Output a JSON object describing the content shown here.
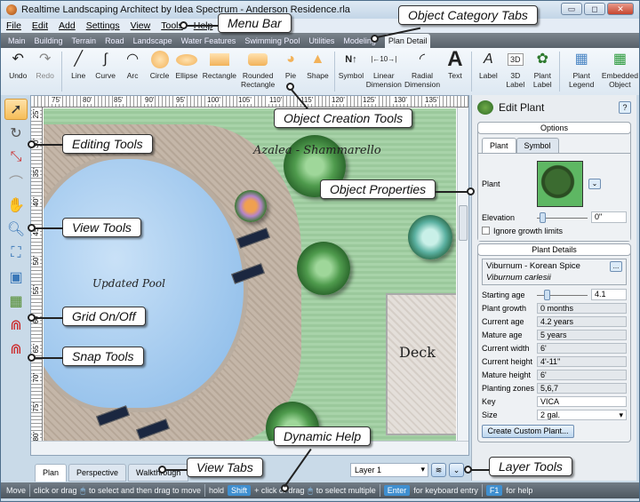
{
  "window": {
    "title": "Realtime Landscaping Architect by Idea Spectrum - Anderson Residence.rla",
    "controls": [
      "minimize",
      "maximize",
      "close"
    ]
  },
  "menu": [
    "File",
    "Edit",
    "Add",
    "Settings",
    "View",
    "Tools",
    "Help"
  ],
  "category_tabs": {
    "items": [
      "Main",
      "Building",
      "Terrain",
      "Road",
      "Landscape",
      "Water Features",
      "Swimming Pool",
      "Utilities",
      "Modeling",
      "Plan Detail"
    ],
    "active": "Plan Detail"
  },
  "ribbon": {
    "history": [
      {
        "label": "Undo",
        "icon": "undo-icon",
        "enabled": true
      },
      {
        "label": "Redo",
        "icon": "redo-icon",
        "enabled": false
      }
    ],
    "shapes": [
      {
        "label": "Line",
        "icon": "line-icon"
      },
      {
        "label": "Curve",
        "icon": "curve-icon"
      },
      {
        "label": "Arc",
        "icon": "arc-icon"
      },
      {
        "label": "Circle",
        "icon": "circle-icon"
      },
      {
        "label": "Ellipse",
        "icon": "ellipse-icon"
      },
      {
        "label": "Rectangle",
        "icon": "rectangle-icon"
      },
      {
        "label": "Rounded Rectangle",
        "icon": "rounded-rectangle-icon"
      },
      {
        "label": "Pie",
        "icon": "pie-icon"
      },
      {
        "label": "Shape",
        "icon": "shape-icon"
      }
    ],
    "annotations": [
      {
        "label": "Symbol",
        "icon": "north-arrow-icon"
      },
      {
        "label": "Linear Dimension",
        "icon": "linear-dimension-icon"
      },
      {
        "label": "Radial Dimension",
        "icon": "radial-dimension-icon"
      },
      {
        "label": "Text",
        "icon": "text-icon"
      }
    ],
    "labels": [
      {
        "label": "Label",
        "icon": "label-icon"
      },
      {
        "label": "3D Label",
        "icon": "3d-label-icon"
      },
      {
        "label": "Plant Label",
        "icon": "plant-label-icon"
      }
    ],
    "objects": [
      {
        "label": "Plant Legend",
        "icon": "plant-legend-icon"
      },
      {
        "label": "Embedded Object",
        "icon": "embedded-object-icon"
      }
    ]
  },
  "rulers": {
    "horizontal": [
      "75'",
      "80'",
      "85'",
      "90'",
      "95'",
      "100'",
      "105'",
      "110'",
      "115'",
      "120'",
      "125'",
      "130'",
      "135'"
    ],
    "vertical": [
      "25'",
      "30'",
      "35'",
      "40'",
      "45'",
      "50'",
      "55'",
      "60'",
      "65'",
      "70'",
      "75'",
      "80'"
    ]
  },
  "left_tools": [
    {
      "name": "select-tool",
      "icon": "arrow-pointer-icon",
      "selected": true
    },
    {
      "name": "rotate-tool",
      "icon": "rotate-icon"
    },
    {
      "name": "resize-tool",
      "icon": "resize-icon"
    },
    {
      "name": "edit-curve-tool",
      "icon": "edit-curve-icon"
    },
    {
      "name": "pan-tool",
      "icon": "hand-icon"
    },
    {
      "name": "zoom-tool",
      "icon": "magnifier-icon"
    },
    {
      "name": "zoom-extents-tool",
      "icon": "zoom-extents-icon"
    },
    {
      "name": "zoom-window-tool",
      "icon": "zoom-window-icon"
    },
    {
      "name": "grid-toggle",
      "icon": "grid-icon"
    },
    {
      "name": "snap-tool",
      "icon": "magnet-icon"
    },
    {
      "name": "snap-options-tool",
      "icon": "magnet-options-icon"
    }
  ],
  "canvas": {
    "labels": {
      "azalea": "Azalea - Shammarello",
      "pool": "Updated Pool",
      "deck": "Deck"
    }
  },
  "view_tabs": {
    "items": [
      "Plan",
      "Perspective",
      "Walkthrough"
    ],
    "active": "Plan"
  },
  "layer": {
    "selected": "Layer 1"
  },
  "status_bar": {
    "mode": "Move",
    "hint1": "click or drag",
    "hint1b": "to select and then drag to move",
    "hold": "hold",
    "shift_key": "Shift",
    "hint2": "+ click or drag",
    "hint2b": "to select multiple",
    "enter_key": "Enter",
    "enter_hint": "for keyboard entry",
    "f1_key": "F1",
    "f1_hint": "for help"
  },
  "panel": {
    "title": "Edit Plant",
    "help": "?",
    "options_header": "Options",
    "tabs": [
      "Plant",
      "Symbol"
    ],
    "active_tab": "Plant",
    "plant_label": "Plant",
    "elevation_label": "Elevation",
    "elevation_value": "0\"",
    "elevation_slider": 0.1,
    "ignore_growth_label": "Ignore growth limits",
    "ignore_growth_checked": false,
    "details_header": "Plant Details",
    "plant_name": "Viburnum - Korean Spice",
    "plant_latin": "Viburnum carlesii",
    "browse_button": "...",
    "starting_age_label": "Starting age",
    "starting_age_value": "4.1",
    "starting_age_slider": 0.2,
    "fields": [
      {
        "label": "Plant growth",
        "value": "0 months"
      },
      {
        "label": "Current age",
        "value": "4.2 years"
      },
      {
        "label": "Mature age",
        "value": "5 years"
      },
      {
        "label": "Current width",
        "value": "6'"
      },
      {
        "label": "Current height",
        "value": "4'-11\""
      },
      {
        "label": "Mature height",
        "value": "6'"
      },
      {
        "label": "Planting zones",
        "value": "5,6,7"
      }
    ],
    "key_label": "Key",
    "key_value": "VICA",
    "size_label": "Size",
    "size_value": "2 gal.",
    "create_button": "Create Custom Plant..."
  },
  "callouts": {
    "menu_bar": "Menu Bar",
    "category_tabs": "Object Category Tabs",
    "creation_tools": "Object Creation Tools",
    "editing_tools": "Editing Tools",
    "object_properties": "Object Properties",
    "view_tools": "View Tools",
    "grid": "Grid On/Off",
    "snap": "Snap Tools",
    "dynamic_help": "Dynamic Help",
    "view_tabs": "View Tabs",
    "layer_tools": "Layer Tools"
  }
}
